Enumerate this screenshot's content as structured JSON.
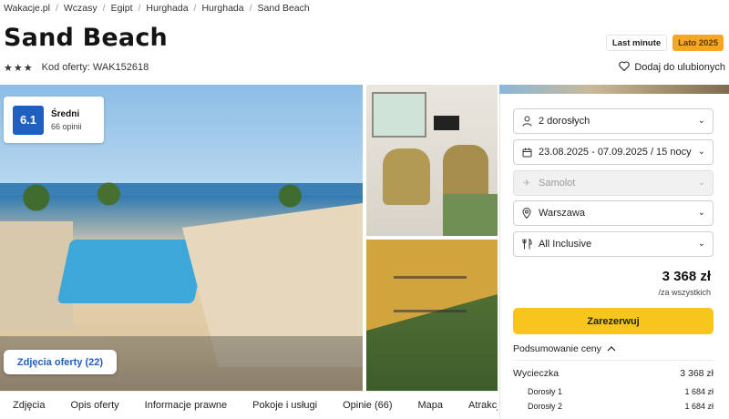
{
  "breadcrumb": [
    "Wakacje.pl",
    "Wczasy",
    "Egipt",
    "Hurghada",
    "Hurghada",
    "Sand Beach"
  ],
  "breadcrumb_separator": "/",
  "title": "Sand Beach",
  "badges": {
    "last_minute": "Last minute",
    "lato": "Lato 2025"
  },
  "stars": 3,
  "offer_code": "Kod oferty: WAK152618",
  "favorite_label": "Dodaj do ulubionych",
  "rating": {
    "score": "6.1",
    "word": "Średni",
    "count": "66 opinii"
  },
  "photos_button": "Zdjęcia oferty (22)",
  "booking": {
    "travelers": "2 dorosłych",
    "dates": "23.08.2025 - 07.09.2025 / 15 nocy",
    "transport": "Samolot",
    "departure": "Warszawa",
    "board": "All Inclusive",
    "price": "3 368 zł",
    "price_note": "/za wszystkich",
    "book_label": "Zarezerwuj",
    "summary_label": "Podsumowanie ceny",
    "summary_total": {
      "label": "Wycieczka",
      "value": "3 368 zł"
    },
    "summary_items": [
      {
        "label": "Dorosły 1",
        "value": "1 684 zł"
      },
      {
        "label": "Dorosły 2",
        "value": "1 684 zł"
      }
    ]
  },
  "tabs": [
    "Zdjęcia",
    "Opis oferty",
    "Informacje prawne",
    "Pokoje i usługi",
    "Opinie (66)",
    "Mapa",
    "Atrakcje"
  ],
  "colors": {
    "accent_blue": "#1f5fbf",
    "cta_yellow": "#f7c51b",
    "badge_orange": "#f6a623"
  }
}
